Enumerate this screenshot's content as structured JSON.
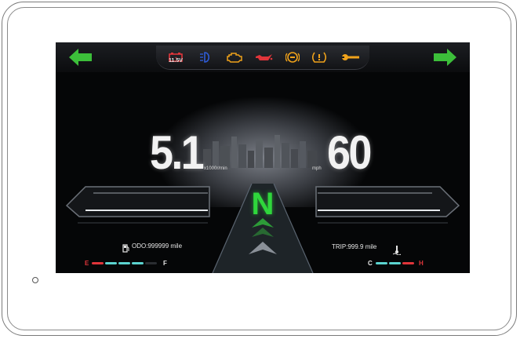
{
  "dashboard": {
    "voltage": "11.5V",
    "rpm_value": "5.1",
    "rpm_unit": "x1000r/min",
    "speed_value": "60",
    "speed_unit": "mph",
    "gear": "N",
    "odometer": "ODO:999999 mile",
    "trip": "TRIP:999.9 mile",
    "fuel": {
      "empty_label": "E",
      "full_label": "F",
      "level_fraction": 0.8
    },
    "temperature": {
      "cold_label": "C",
      "hot_label": "H",
      "level_fraction": 0.6
    }
  },
  "indicators": [
    {
      "icon": "battery-icon",
      "color": "#e0353a"
    },
    {
      "icon": "headlight-high-beam-icon",
      "color": "#2e5bd6"
    },
    {
      "icon": "engine-check-icon",
      "color": "#f0a21a"
    },
    {
      "icon": "oil-pressure-icon",
      "color": "#e0353a"
    },
    {
      "icon": "brake-warning-icon",
      "color": "#f0a21a"
    },
    {
      "icon": "tire-pressure-icon",
      "color": "#f0a21a"
    },
    {
      "icon": "wrench-service-icon",
      "color": "#f0a21a"
    }
  ],
  "turn_signals": {
    "left": "left-turn-arrow-icon",
    "right": "right-turn-arrow-icon",
    "color": "#3cbf3a"
  },
  "colors": {
    "screen_bg": "#050607",
    "gear_green": "#2fd63c",
    "gauge_red": "#e0353a",
    "gauge_cyan": "#5bd3cf"
  }
}
